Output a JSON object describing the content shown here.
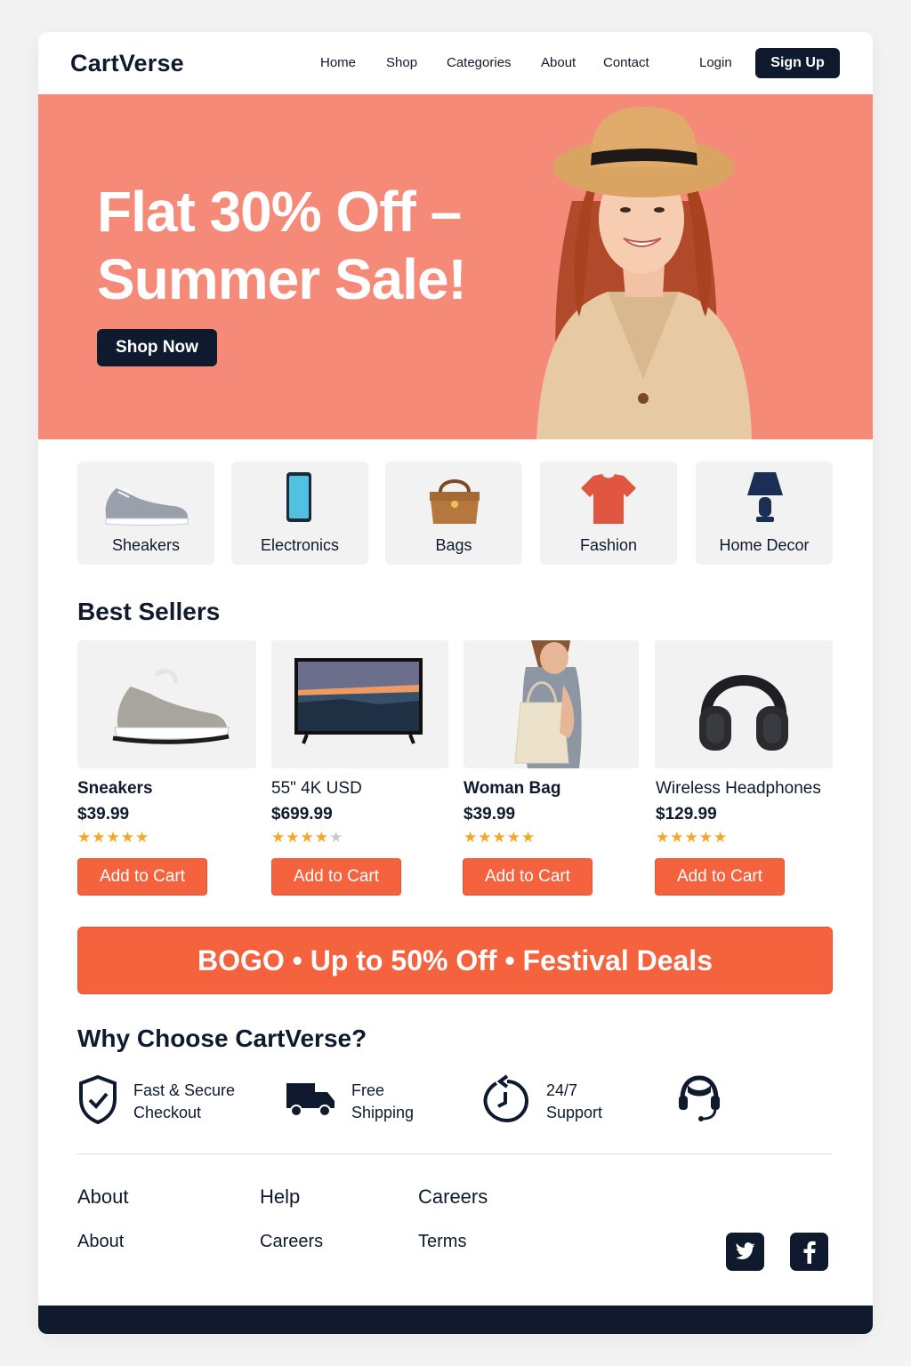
{
  "header": {
    "logo": "CartVerse",
    "nav": [
      "Home",
      "Shop",
      "Categories",
      "About",
      "Contact"
    ],
    "login": "Login",
    "signup": "Sign Up"
  },
  "hero": {
    "title": "Flat 30% Off – Summer Sale!",
    "cta": "Shop Now",
    "background_color": "#f58a78"
  },
  "categories": [
    {
      "label": "Sheakers",
      "icon": "sneaker-icon"
    },
    {
      "label": "Electronics",
      "icon": "phone-icon"
    },
    {
      "label": "Bags",
      "icon": "handbag-icon"
    },
    {
      "label": "Fashion",
      "icon": "tshirt-icon"
    },
    {
      "label": "Home Decor",
      "icon": "lamp-icon"
    }
  ],
  "best_sellers": {
    "title": "Best Sellers",
    "products": [
      {
        "name": "Sneakers",
        "price": "$39.99",
        "rating": 5,
        "cta": "Add to Cart"
      },
      {
        "name": "55\" 4K USD",
        "price": "$699.99",
        "rating": 4,
        "cta": "Add to Cart"
      },
      {
        "name": "Woman Bag",
        "price": "$39.99",
        "rating": 5,
        "cta": "Add to Cart"
      },
      {
        "name": "Wireless Headphones",
        "price": "$129.99",
        "rating": 5,
        "cta": "Add to Cart"
      }
    ]
  },
  "promo": {
    "text": "BOGO • Up to 50% Off • Festival Deals",
    "color": "#f4623e"
  },
  "why": {
    "title": "Why Choose CartVerse?",
    "features": [
      {
        "line1": "Fast & Secure",
        "line2": "Checkout",
        "icon": "shield-check-icon"
      },
      {
        "line1": "Free",
        "line2": "Shipping",
        "icon": "truck-icon"
      },
      {
        "line1": "24/7",
        "line2": "Support",
        "icon": "refresh-icon"
      },
      {
        "line1": "",
        "line2": "",
        "icon": "headset-icon"
      }
    ]
  },
  "footer": {
    "headings": [
      "About",
      "Help",
      "Careers"
    ],
    "links": [
      "About",
      "Careers",
      "Terms"
    ],
    "social": [
      "twitter-icon",
      "facebook-icon"
    ]
  },
  "colors": {
    "navy": "#0f1a2e",
    "accent": "#f4623e",
    "star": "#f5a623"
  }
}
